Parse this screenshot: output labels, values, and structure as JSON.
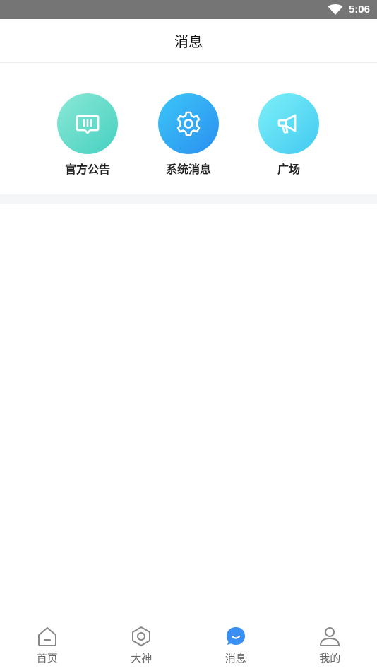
{
  "status_bar": {
    "time": "5:06",
    "wifi_icon": "wifi-icon"
  },
  "header": {
    "title": "消息"
  },
  "shortcuts": [
    {
      "label": "官方公告",
      "icon": "message-box-icon",
      "color": "#46d0c0"
    },
    {
      "label": "系统消息",
      "icon": "gear-icon",
      "color": "#2a8ff0"
    },
    {
      "label": "广场",
      "icon": "megaphone-icon",
      "color": "#42c9f0"
    }
  ],
  "tabbar": {
    "active": "消息",
    "active_color": "#3a8ff2",
    "items": [
      {
        "label": "首页",
        "icon": "home-icon"
      },
      {
        "label": "大神",
        "icon": "hexagon-icon"
      },
      {
        "label": "消息",
        "icon": "chat-bubble-icon"
      },
      {
        "label": "我的",
        "icon": "profile-icon"
      }
    ]
  }
}
